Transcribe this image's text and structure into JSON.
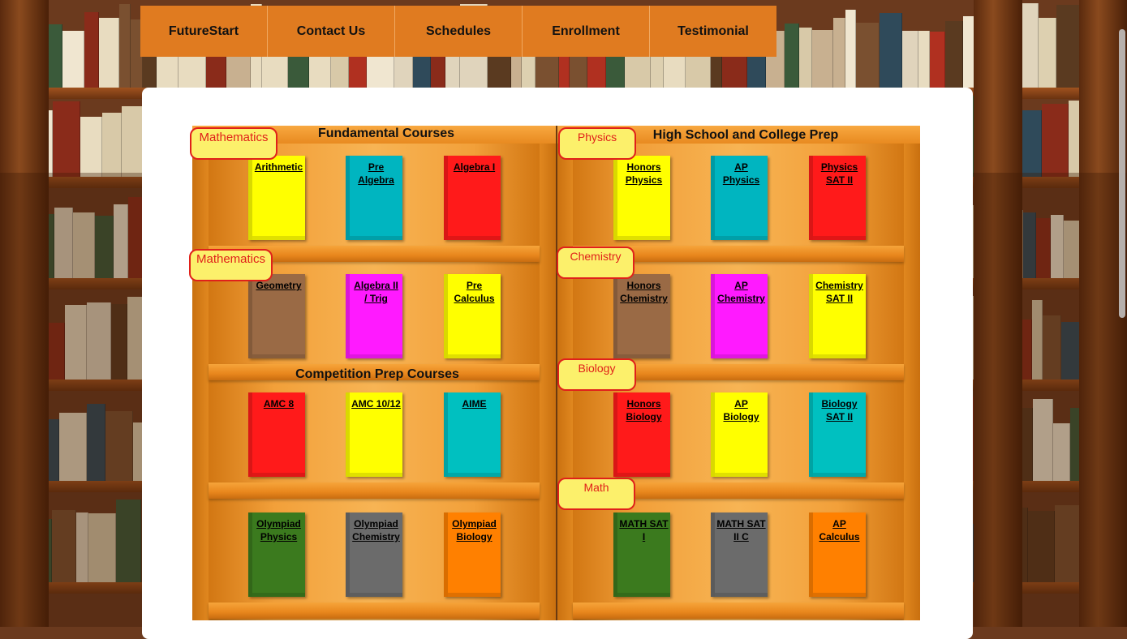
{
  "nav": {
    "items": [
      "FutureStart",
      "Contact Us",
      "Schedules",
      "Enrollment",
      "Testimonial"
    ]
  },
  "left_case": {
    "title": "Fundamental Courses",
    "section2_title": "Competition Prep Courses",
    "labels": [
      "Mathematics",
      "Mathematics"
    ],
    "rows": [
      [
        {
          "label": "Arithmetic",
          "color": "#ffff00"
        },
        {
          "label": "Pre Algebra",
          "color": "#00b5c0"
        },
        {
          "label": "Algebra I",
          "color": "#ff1a1a"
        }
      ],
      [
        {
          "label": "Geometry",
          "color": "#9a6a45"
        },
        {
          "label": "Algebra II / Trig",
          "color": "#ff1aff"
        },
        {
          "label": "Pre Calculus",
          "color": "#ffff00"
        }
      ],
      [
        {
          "label": "AMC 8",
          "color": "#ff1a1a"
        },
        {
          "label": "AMC 10/12",
          "color": "#ffff00"
        },
        {
          "label": "AIME",
          "color": "#00c0c0"
        }
      ],
      [
        {
          "label": "Olympiad Physics",
          "color": "#3b7a1e"
        },
        {
          "label": "Olympiad Chemistry",
          "color": "#6b6b6b"
        },
        {
          "label": "Olympiad Biology",
          "color": "#ff8000"
        }
      ]
    ]
  },
  "right_case": {
    "title": "High School and College Prep",
    "labels": [
      "Physics",
      "Chemistry",
      "Biology",
      "Math"
    ],
    "rows": [
      [
        {
          "label": "Honors Physics",
          "color": "#ffff00"
        },
        {
          "label": "AP Physics",
          "color": "#00b5c0"
        },
        {
          "label": "Physics SAT II",
          "color": "#ff1a1a"
        }
      ],
      [
        {
          "label": "Honors Chemistry",
          "color": "#9a6a45"
        },
        {
          "label": "AP Chemistry",
          "color": "#ff1aff"
        },
        {
          "label": "Chemistry SAT II",
          "color": "#ffff00"
        }
      ],
      [
        {
          "label": "Honors Biology",
          "color": "#ff1a1a"
        },
        {
          "label": "AP Biology",
          "color": "#ffff00"
        },
        {
          "label": "Biology SAT II",
          "color": "#00c0c0"
        }
      ],
      [
        {
          "label": "MATH SAT I",
          "color": "#3b7a1e"
        },
        {
          "label": "MATH SAT II C",
          "color": "#6b6b6b"
        },
        {
          "label": "AP Calculus",
          "color": "#ff8000"
        }
      ]
    ]
  }
}
